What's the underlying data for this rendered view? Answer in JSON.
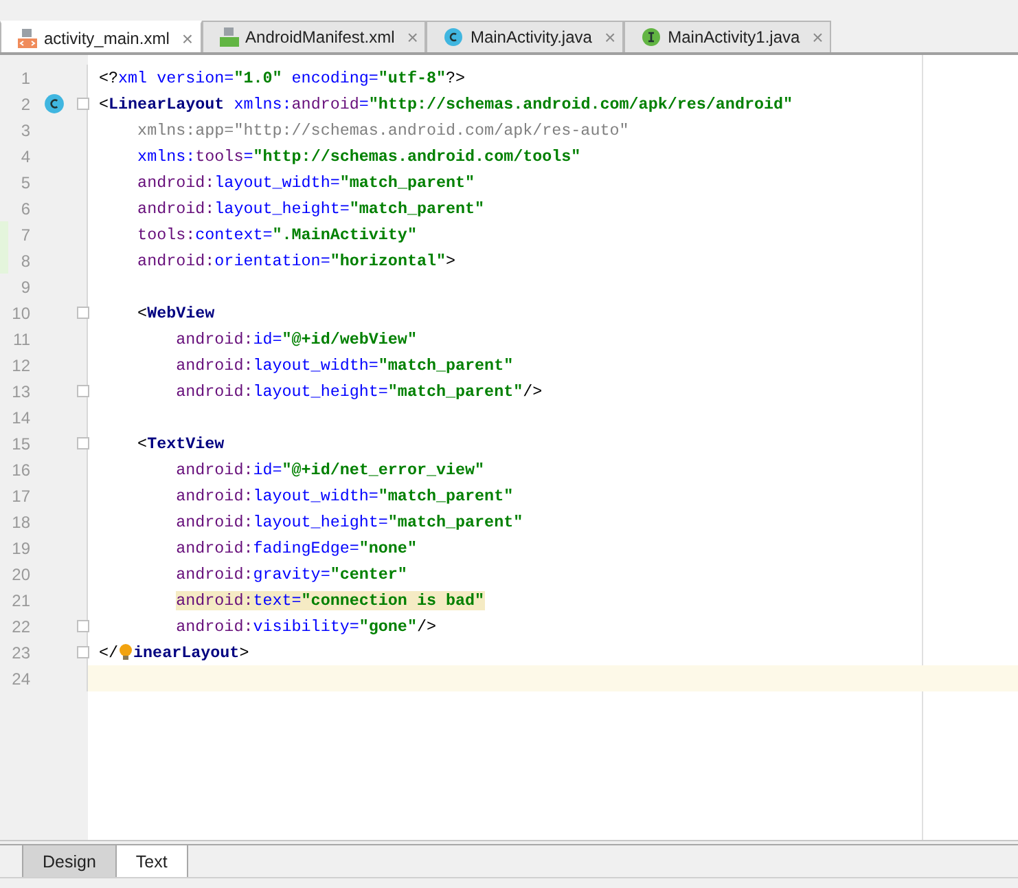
{
  "file_tabs": [
    {
      "label": "activity_main.xml",
      "kind": "xml",
      "selected": true,
      "close": "×"
    },
    {
      "label": "AndroidManifest.xml",
      "kind": "manifest",
      "selected": false,
      "close": "×"
    },
    {
      "label": "MainActivity.java",
      "kind": "class",
      "selected": false,
      "close": "×"
    },
    {
      "label": "MainActivity1.java",
      "kind": "interface",
      "selected": false,
      "close": "×"
    }
  ],
  "editor": {
    "lines": [
      {
        "number": "1",
        "tokens": [
          {
            "kind": "punct",
            "text": "<?"
          },
          {
            "kind": "ns",
            "text": "xml"
          },
          {
            "kind": "ns",
            "text": " version="
          },
          {
            "kind": "plain",
            "text": "\"1.0\""
          },
          {
            "kind": "ns",
            "text": " encoding="
          },
          {
            "kind": "plain",
            "text": "\"utf-8\""
          },
          {
            "kind": "punct",
            "text": "?>"
          }
        ]
      },
      {
        "number": "2",
        "gutter_icon": true,
        "fold": true,
        "tokens": [
          {
            "kind": "punct",
            "text": "<"
          },
          {
            "kind": "tag",
            "text": "LinearLayout"
          },
          {
            "kind": "ns",
            "text": " xmlns:"
          },
          {
            "kind": "attr",
            "text": "android"
          },
          {
            "kind": "ns",
            "text": "="
          },
          {
            "kind": "value",
            "text": "\"http://schemas.android.com/apk/res/android\""
          }
        ]
      },
      {
        "number": "3",
        "tokens": [
          {
            "kind": "grey",
            "text": "    xmlns:app=\"http://schemas.android.com/apk/res-auto\""
          }
        ]
      },
      {
        "number": "4",
        "tokens": [
          {
            "kind": "ns",
            "text": "    xmlns:"
          },
          {
            "kind": "attr",
            "text": "tools"
          },
          {
            "kind": "ns",
            "text": "="
          },
          {
            "kind": "value",
            "text": "\"http://schemas.android.com/tools\""
          }
        ]
      },
      {
        "number": "5",
        "tokens": [
          {
            "kind": "attr",
            "text": "    android:"
          },
          {
            "kind": "ns",
            "text": "layout_width="
          },
          {
            "kind": "value",
            "text": "\"match_parent\""
          }
        ]
      },
      {
        "number": "6",
        "tokens": [
          {
            "kind": "attr",
            "text": "    android:"
          },
          {
            "kind": "ns",
            "text": "layout_height="
          },
          {
            "kind": "value",
            "text": "\"match_parent\""
          }
        ]
      },
      {
        "number": "7",
        "changed": true,
        "tokens": [
          {
            "kind": "attr",
            "text": "    tools:"
          },
          {
            "kind": "ns",
            "text": "context="
          },
          {
            "kind": "value",
            "text": "\".MainActivity\""
          }
        ]
      },
      {
        "number": "8",
        "changed": true,
        "tokens": [
          {
            "kind": "attr",
            "text": "    android:"
          },
          {
            "kind": "ns",
            "text": "orientation="
          },
          {
            "kind": "value",
            "text": "\"horizontal\""
          },
          {
            "kind": "punct",
            "text": ">"
          }
        ]
      },
      {
        "number": "9"
      },
      {
        "number": "10",
        "fold": true,
        "tokens": [
          {
            "kind": "punct",
            "text": "    <"
          },
          {
            "kind": "tag",
            "text": "WebView"
          }
        ]
      },
      {
        "number": "11",
        "tokens": [
          {
            "kind": "attr",
            "text": "        android:"
          },
          {
            "kind": "ns",
            "text": "id="
          },
          {
            "kind": "value",
            "text": "\"@+id/webView\""
          }
        ]
      },
      {
        "number": "12",
        "tokens": [
          {
            "kind": "attr",
            "text": "        android:"
          },
          {
            "kind": "ns",
            "text": "layout_width="
          },
          {
            "kind": "value",
            "text": "\"match_parent\""
          }
        ]
      },
      {
        "number": "13",
        "fold": true,
        "tokens": [
          {
            "kind": "attr",
            "text": "        android:"
          },
          {
            "kind": "ns",
            "text": "layout_height="
          },
          {
            "kind": "value",
            "text": "\"match_parent\""
          },
          {
            "kind": "punct",
            "text": "/>"
          }
        ]
      },
      {
        "number": "14"
      },
      {
        "number": "15",
        "fold": true,
        "tokens": [
          {
            "kind": "punct",
            "text": "    <"
          },
          {
            "kind": "tag",
            "text": "TextView"
          }
        ]
      },
      {
        "number": "16",
        "tokens": [
          {
            "kind": "attr",
            "text": "        android:"
          },
          {
            "kind": "ns",
            "text": "id="
          },
          {
            "kind": "value",
            "text": "\"@+id/net_error_view\""
          }
        ]
      },
      {
        "number": "17",
        "tokens": [
          {
            "kind": "attr",
            "text": "        android:"
          },
          {
            "kind": "ns",
            "text": "layout_width="
          },
          {
            "kind": "value",
            "text": "\"match_parent\""
          }
        ]
      },
      {
        "number": "18",
        "tokens": [
          {
            "kind": "attr",
            "text": "        android:"
          },
          {
            "kind": "ns",
            "text": "layout_height="
          },
          {
            "kind": "value",
            "text": "\"match_parent\""
          }
        ]
      },
      {
        "number": "19",
        "tokens": [
          {
            "kind": "attr",
            "text": "        android:"
          },
          {
            "kind": "ns",
            "text": "fadingEdge="
          },
          {
            "kind": "value",
            "text": "\"none\""
          }
        ]
      },
      {
        "number": "20",
        "tokens": [
          {
            "kind": "attr",
            "text": "        android:"
          },
          {
            "kind": "ns",
            "text": "gravity="
          },
          {
            "kind": "value",
            "text": "\"center\""
          }
        ]
      },
      {
        "number": "21",
        "highlighted": true,
        "tokens": [
          {
            "kind": "attr",
            "text": "        android:"
          },
          {
            "kind": "ns",
            "text": "text="
          },
          {
            "kind": "value",
            "text": "\"connection is bad\""
          }
        ]
      },
      {
        "number": "22",
        "fold": true,
        "tokens": [
          {
            "kind": "attr",
            "text": "        android:"
          },
          {
            "kind": "ns",
            "text": "visibility="
          },
          {
            "kind": "value",
            "text": "\"gone\""
          },
          {
            "kind": "punct",
            "text": "/>"
          }
        ]
      },
      {
        "number": "23",
        "fold": true,
        "tokens": [
          {
            "kind": "punct",
            "text": "</"
          },
          {
            "kind": "bulb"
          },
          {
            "kind": "tag",
            "text": "inearLayout"
          },
          {
            "kind": "punct",
            "text": ">"
          }
        ]
      },
      {
        "number": "24",
        "current": true
      }
    ]
  },
  "view_tabs": [
    {
      "label": "Design",
      "selected": false
    },
    {
      "label": "Text",
      "selected": true
    }
  ]
}
